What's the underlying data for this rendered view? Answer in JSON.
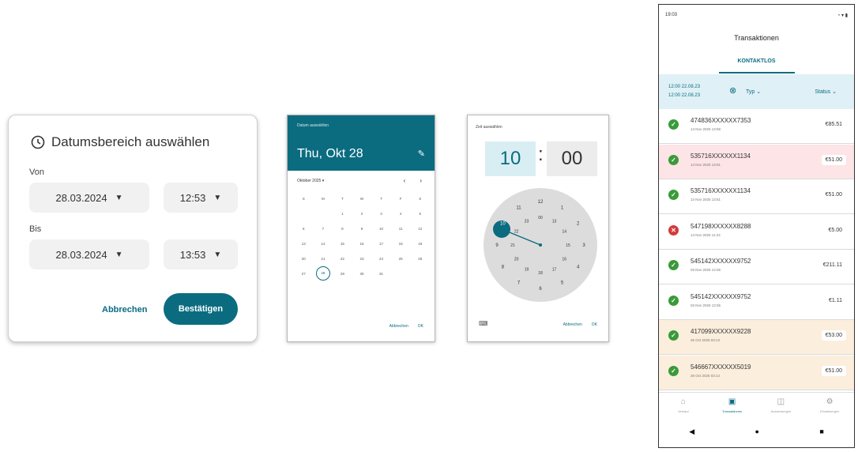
{
  "date_range_dialog": {
    "title": "Datumsbereich auswählen",
    "from_label": "Von",
    "from_date": "28.03.2024",
    "from_time": "12:53",
    "to_label": "Bis",
    "to_date": "28.03.2024",
    "to_time": "13:53",
    "cancel": "Abbrechen",
    "confirm": "Bestätigen"
  },
  "date_picker": {
    "small_label": "Datum auswählen",
    "selected_date": "Thu, Okt 28",
    "month_label": "Oktober 2025",
    "weekdays": [
      "S",
      "M",
      "T",
      "W",
      "T",
      "F",
      "S"
    ],
    "days": [
      "",
      "",
      "1",
      "2",
      "3",
      "4",
      "5",
      "6",
      "7",
      "8",
      "9",
      "10",
      "11",
      "12",
      "13",
      "14",
      "15",
      "16",
      "17",
      "18",
      "19",
      "20",
      "21",
      "22",
      "23",
      "24",
      "25",
      "26",
      "27",
      "28",
      "29",
      "30",
      "31",
      "",
      "",
      ""
    ],
    "selected_day": "28",
    "cancel": "Abbrechen",
    "ok": "OK"
  },
  "time_picker": {
    "small_label": "Zeit auswählen",
    "hour": "10",
    "separator": ":",
    "minute": "00",
    "cancel": "Abbrechen",
    "ok": "OK",
    "clock_outer": [
      "12",
      "1",
      "2",
      "3",
      "4",
      "5",
      "6",
      "7",
      "8",
      "9",
      "10",
      "11"
    ],
    "clock_inner": [
      "00",
      "13",
      "14",
      "15",
      "16",
      "17",
      "18",
      "19",
      "20",
      "21",
      "22",
      "23"
    ]
  },
  "transactions_app": {
    "status_time": "19:03",
    "title": "Transaktionen",
    "tab": "KONTAKTLOS",
    "filter": {
      "from": "12:00  22.08.23",
      "to": "12:00  22.08.23",
      "type": "Typ",
      "status": "Status"
    },
    "rows": [
      {
        "card": "474836XXXXXX7353",
        "date": "14 Nov 2025 13:58",
        "amount": "€85.51",
        "ok": true,
        "bg": "#ffffff"
      },
      {
        "card": "535716XXXXXX1134",
        "date": "14 Nov 2025 13:51",
        "amount": "€51.00",
        "ok": true,
        "bg": "#fde4e6"
      },
      {
        "card": "535716XXXXXX1134",
        "date": "14 Nov 2025 13:51",
        "amount": "€51.00",
        "ok": true,
        "bg": "#ffffff"
      },
      {
        "card": "547198XXXXXX8288",
        "date": "14 Nov 2025 11:24",
        "amount": "€5.00",
        "ok": false,
        "bg": "#ffffff"
      },
      {
        "card": "545142XXXXXX9752",
        "date": "03 Nov 2025 13:36",
        "amount": "€211.11",
        "ok": true,
        "bg": "#ffffff"
      },
      {
        "card": "545142XXXXXX9752",
        "date": "03 Nov 2025 13:36",
        "amount": "€1.11",
        "ok": true,
        "bg": "#ffffff"
      },
      {
        "card": "417099XXXXXX9228",
        "date": "26 Oct 2025 03:13",
        "amount": "€53.00",
        "ok": true,
        "bg": "#fbeedd"
      },
      {
        "card": "546667XXXXXX5019",
        "date": "26 Oct 2025 03:14",
        "amount": "€51.00",
        "ok": true,
        "bg": "#fbeedd"
      }
    ],
    "bottom_nav": [
      "Verkauf",
      "Transaktionen",
      "Auswertungen",
      "Einstellungen"
    ],
    "colors": {
      "accent": "#0b6c80",
      "ok": "#3a9a3a",
      "error": "#d43a3a"
    }
  }
}
